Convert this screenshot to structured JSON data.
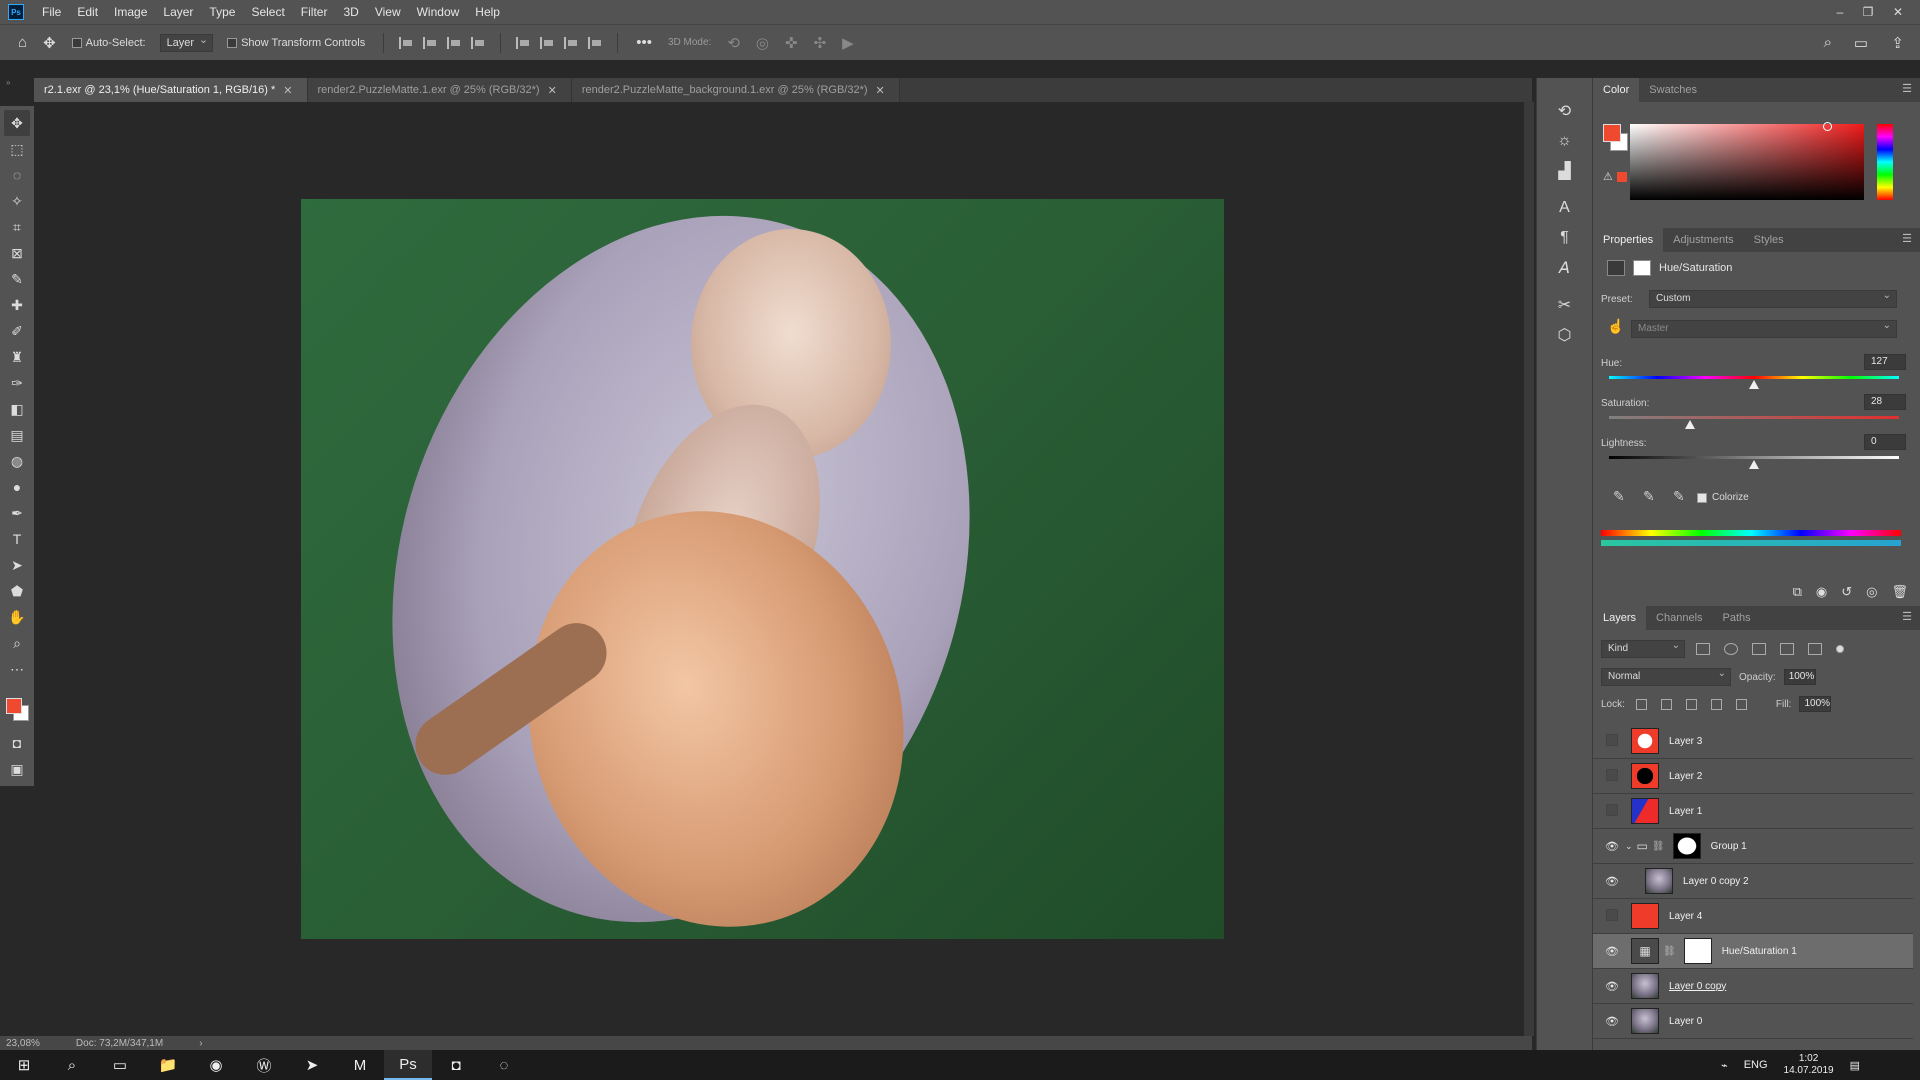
{
  "app": {
    "logo": "Ps",
    "menu": [
      "File",
      "Edit",
      "Image",
      "Layer",
      "Type",
      "Select",
      "Filter",
      "3D",
      "View",
      "Window",
      "Help"
    ],
    "window_controls": [
      "–",
      "❐",
      "✕"
    ]
  },
  "options_bar": {
    "auto_select_label": "Auto-Select:",
    "auto_select_target": "Layer",
    "show_transform_label": "Show Transform Controls",
    "mode_label": "3D Mode:",
    "more_label": "•••"
  },
  "tabs": [
    {
      "label": "r2.1.exr @ 23,1% (Hue/Saturation 1, RGB/16) *",
      "active": true
    },
    {
      "label": "render2.PuzzleMatte.1.exr @ 25% (RGB/32*)",
      "active": false
    },
    {
      "label": "render2.PuzzleMatte_background.1.exr @ 25% (RGB/32*)",
      "active": false
    }
  ],
  "tab_close": "✕",
  "status": {
    "zoom": "23,08%",
    "doc": "Doc: 73,2M/347,1M",
    "arrow": "›"
  },
  "colors": {
    "foreground": "#ef4a30",
    "background": "#ffffff",
    "accent": "#31a8ff"
  },
  "color_panel": {
    "tabs": [
      "Color",
      "Swatches"
    ],
    "warning_icon": "⚠"
  },
  "properties": {
    "tabs": [
      "Properties",
      "Adjustments",
      "Styles"
    ],
    "title": "Hue/Saturation",
    "preset_label": "Preset:",
    "preset_value": "Custom",
    "channel_value": "Master",
    "hue_label": "Hue:",
    "hue_value": "127",
    "saturation_label": "Saturation:",
    "saturation_value": "28",
    "lightness_label": "Lightness:",
    "lightness_value": "0",
    "colorize_label": "Colorize",
    "colorize_checked": true,
    "hue_fraction": 0.5,
    "saturation_fraction": 0.28,
    "lightness_fraction": 0.5
  },
  "layers_panel": {
    "tabs": [
      "Layers",
      "Channels",
      "Paths"
    ],
    "kind_label": "Kind",
    "blend_mode": "Normal",
    "opacity_label": "Opacity:",
    "opacity_value": "100%",
    "lock_label": "Lock:",
    "fill_label": "Fill:",
    "fill_value": "100%",
    "layers": [
      {
        "name": "Layer 3",
        "visible": false,
        "thumb": "l3"
      },
      {
        "name": "Layer 2",
        "visible": false,
        "thumb": "l2"
      },
      {
        "name": "Layer 1",
        "visible": false,
        "thumb": "l1"
      },
      {
        "name": "Group 1",
        "visible": true,
        "thumb": "groupmask",
        "group": true
      },
      {
        "name": "Layer 0 copy 2",
        "visible": true,
        "thumb": "photo",
        "indent": true
      },
      {
        "name": "Layer 4",
        "visible": false,
        "thumb": "red"
      },
      {
        "name": "Hue/Saturation 1",
        "visible": true,
        "thumb": "adj",
        "selected": true,
        "mask": true
      },
      {
        "name": "Layer 0 copy",
        "visible": true,
        "thumb": "photo",
        "underline": true
      },
      {
        "name": "Layer 0",
        "visible": true,
        "thumb": "photo"
      }
    ]
  },
  "taskbar": {
    "lang": "ENG",
    "time": "1:02",
    "date": "14.07.2019"
  }
}
